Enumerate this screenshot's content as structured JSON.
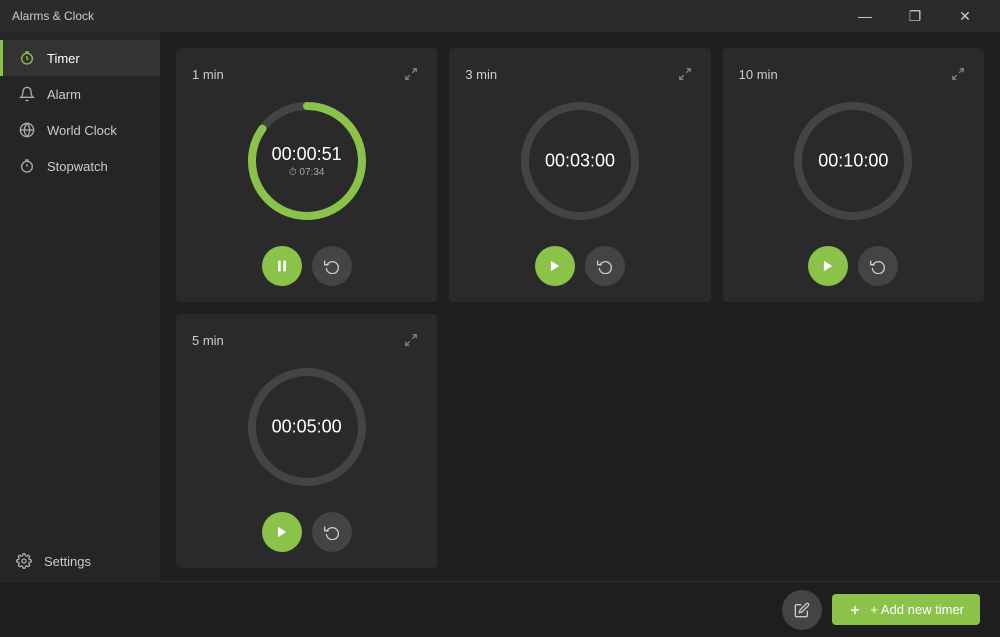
{
  "app": {
    "title": "Alarms & Clock",
    "window_controls": {
      "minimize": "—",
      "maximize": "❐",
      "close": "✕"
    }
  },
  "sidebar": {
    "items": [
      {
        "id": "timer",
        "label": "Timer",
        "active": true,
        "icon": "timer-icon"
      },
      {
        "id": "alarm",
        "label": "Alarm",
        "active": false,
        "icon": "alarm-icon"
      },
      {
        "id": "world-clock",
        "label": "World Clock",
        "active": false,
        "icon": "world-clock-icon"
      },
      {
        "id": "stopwatch",
        "label": "Stopwatch",
        "active": false,
        "icon": "stopwatch-icon"
      }
    ],
    "settings": {
      "label": "Settings",
      "icon": "settings-icon"
    }
  },
  "timers": [
    {
      "id": "timer1",
      "label": "1 min",
      "time_display": "00:00:51",
      "sub_display": "⏱ 07:34",
      "is_running": true,
      "progress_pct": 85,
      "ring_color": "#8bc34a"
    },
    {
      "id": "timer2",
      "label": "3 min",
      "time_display": "00:03:00",
      "sub_display": "",
      "is_running": false,
      "progress_pct": 0,
      "ring_color": "#555"
    },
    {
      "id": "timer3",
      "label": "10 min",
      "time_display": "00:10:00",
      "sub_display": "",
      "is_running": false,
      "progress_pct": 0,
      "ring_color": "#555"
    },
    {
      "id": "timer4",
      "label": "5 min",
      "time_display": "00:05:00",
      "sub_display": "",
      "is_running": false,
      "progress_pct": 0,
      "ring_color": "#555"
    }
  ],
  "bottom_bar": {
    "edit_label": "✏",
    "add_timer_label": "+ Add new timer"
  }
}
